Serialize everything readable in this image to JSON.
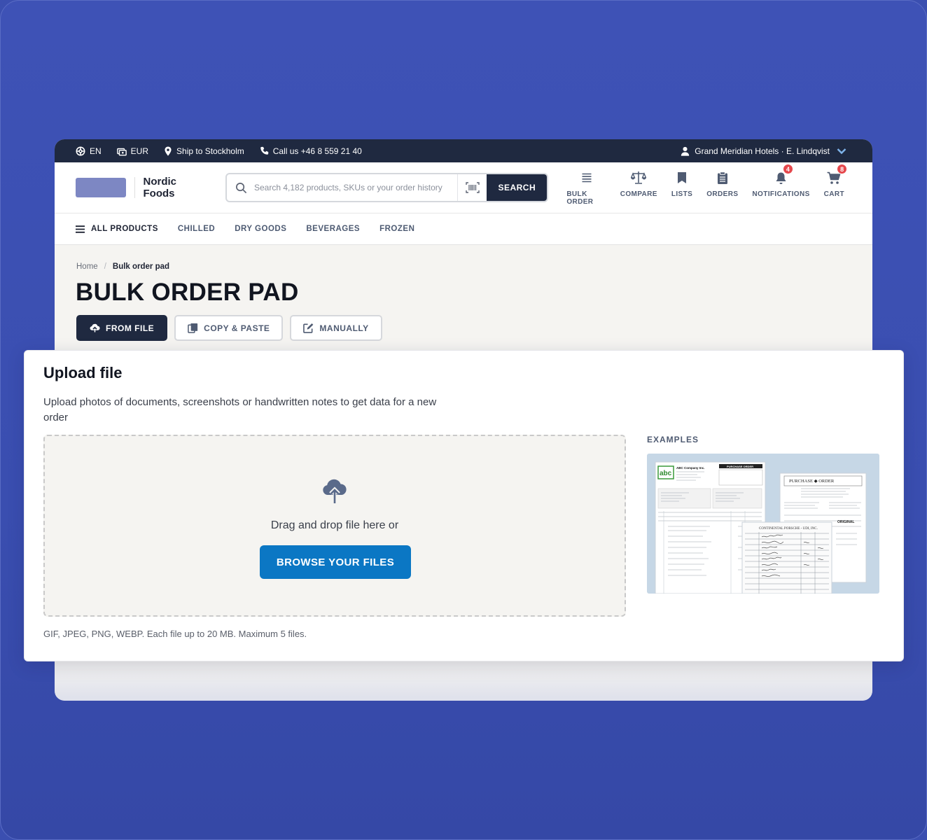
{
  "topbar": {
    "language": "EN",
    "currency": "EUR",
    "ship_to": "Ship to Stockholm",
    "phone": "Call us +46 8 559 21 40",
    "account": "Grand Meridian Hotels · E. Lindqvist"
  },
  "header": {
    "brand": "Nordic Foods",
    "search_placeholder": "Search 4,182 products, SKUs or your order history",
    "search_button": "SEARCH",
    "nav": [
      {
        "label": "BULK ORDER",
        "icon": "list-icon"
      },
      {
        "label": "COMPARE",
        "icon": "scale-icon"
      },
      {
        "label": "LISTS",
        "icon": "bookmark-icon"
      },
      {
        "label": "ORDERS",
        "icon": "clipboard-icon"
      },
      {
        "label": "NOTIFICATIONS",
        "icon": "bell-icon",
        "badge": "4"
      },
      {
        "label": "CART",
        "icon": "cart-icon",
        "badge": "8"
      }
    ]
  },
  "categories": [
    "ALL PRODUCTS",
    "CHILLED",
    "DRY GOODS",
    "BEVERAGES",
    "FROZEN"
  ],
  "breadcrumb": {
    "home": "Home",
    "current": "Bulk order pad"
  },
  "page_title": "BULK ORDER PAD",
  "tabs": [
    {
      "label": "FROM FILE",
      "active": true
    },
    {
      "label": "COPY & PASTE",
      "active": false
    },
    {
      "label": "MANUALLY",
      "active": false
    }
  ],
  "upload": {
    "title": "Upload file",
    "description": "Upload photos of documents, screenshots or handwritten notes to get data for a new order",
    "drop_text": "Drag and drop file here or",
    "browse_button": "BROWSE YOUR FILES",
    "hint": "GIF, JPEG, PNG, WEBP. Each file up to 20 MB. Maximum 5 files.",
    "examples_label": "EXAMPLES"
  },
  "example_docs": {
    "doc1_company": "ABC Company Inc.",
    "doc1_heading": "PURCHASE ORDER",
    "doc1_logo": "abc",
    "doc2_heading": "PURCHASE ◆ ORDER",
    "doc3_heading": "CONTINENTAL PORSCHE - UDI, INC.",
    "doc2_stamp": "ORIGINAL"
  },
  "colors": {
    "background": "#3b4fb0",
    "dark": "#1f2940",
    "accent": "#0b77c4",
    "badge": "#e5484d"
  }
}
